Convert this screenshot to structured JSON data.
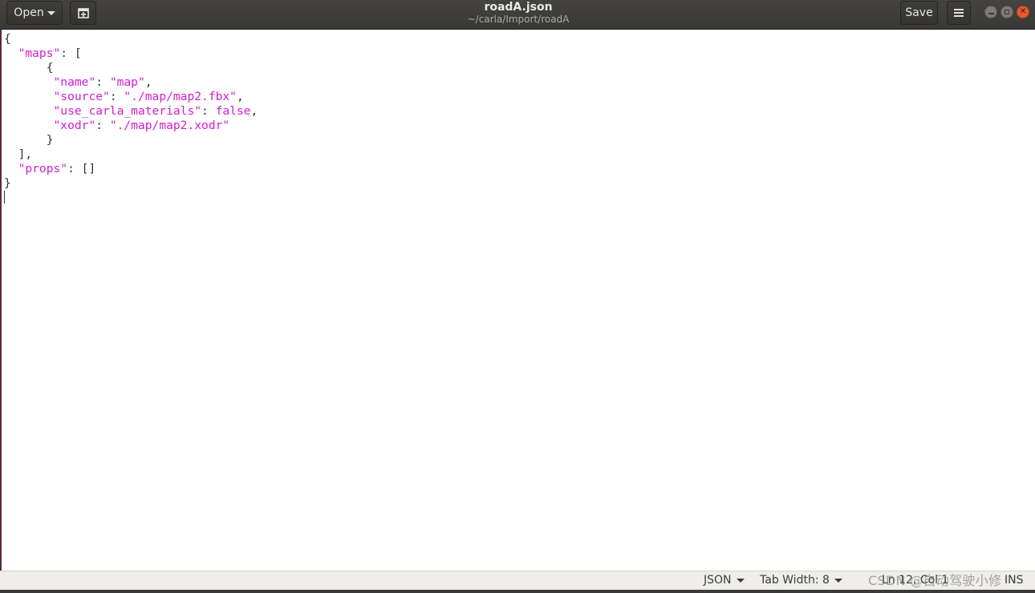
{
  "header": {
    "open_label": "Open",
    "save_label": "Save",
    "title": "roadA.json",
    "subtitle": "~/carla/Import/roadA"
  },
  "editor": {
    "lines": [
      "{",
      "  \"maps\": [",
      "      {",
      "       \"name\": \"map\",",
      "       \"source\": \"./map/map2.fbx\",",
      "       \"use_carla_materials\": false,",
      "       \"xodr\": \"./map/map2.xodr\"",
      "      }",
      "  ],",
      "  \"props\": []",
      "}"
    ],
    "syntax_color": "#d020d0"
  },
  "statusbar": {
    "language": "JSON",
    "tab_width": "Tab Width: 8",
    "position": "Ln 12, Col 1",
    "mode": "INS"
  },
  "watermark": "CSDN @自动驾驶小修",
  "icons": {
    "new_tab": "new-document-tab-icon",
    "menu": "hamburger-menu-icon",
    "window_controls": [
      "minimize-icon",
      "maximize-icon",
      "close-icon"
    ]
  }
}
